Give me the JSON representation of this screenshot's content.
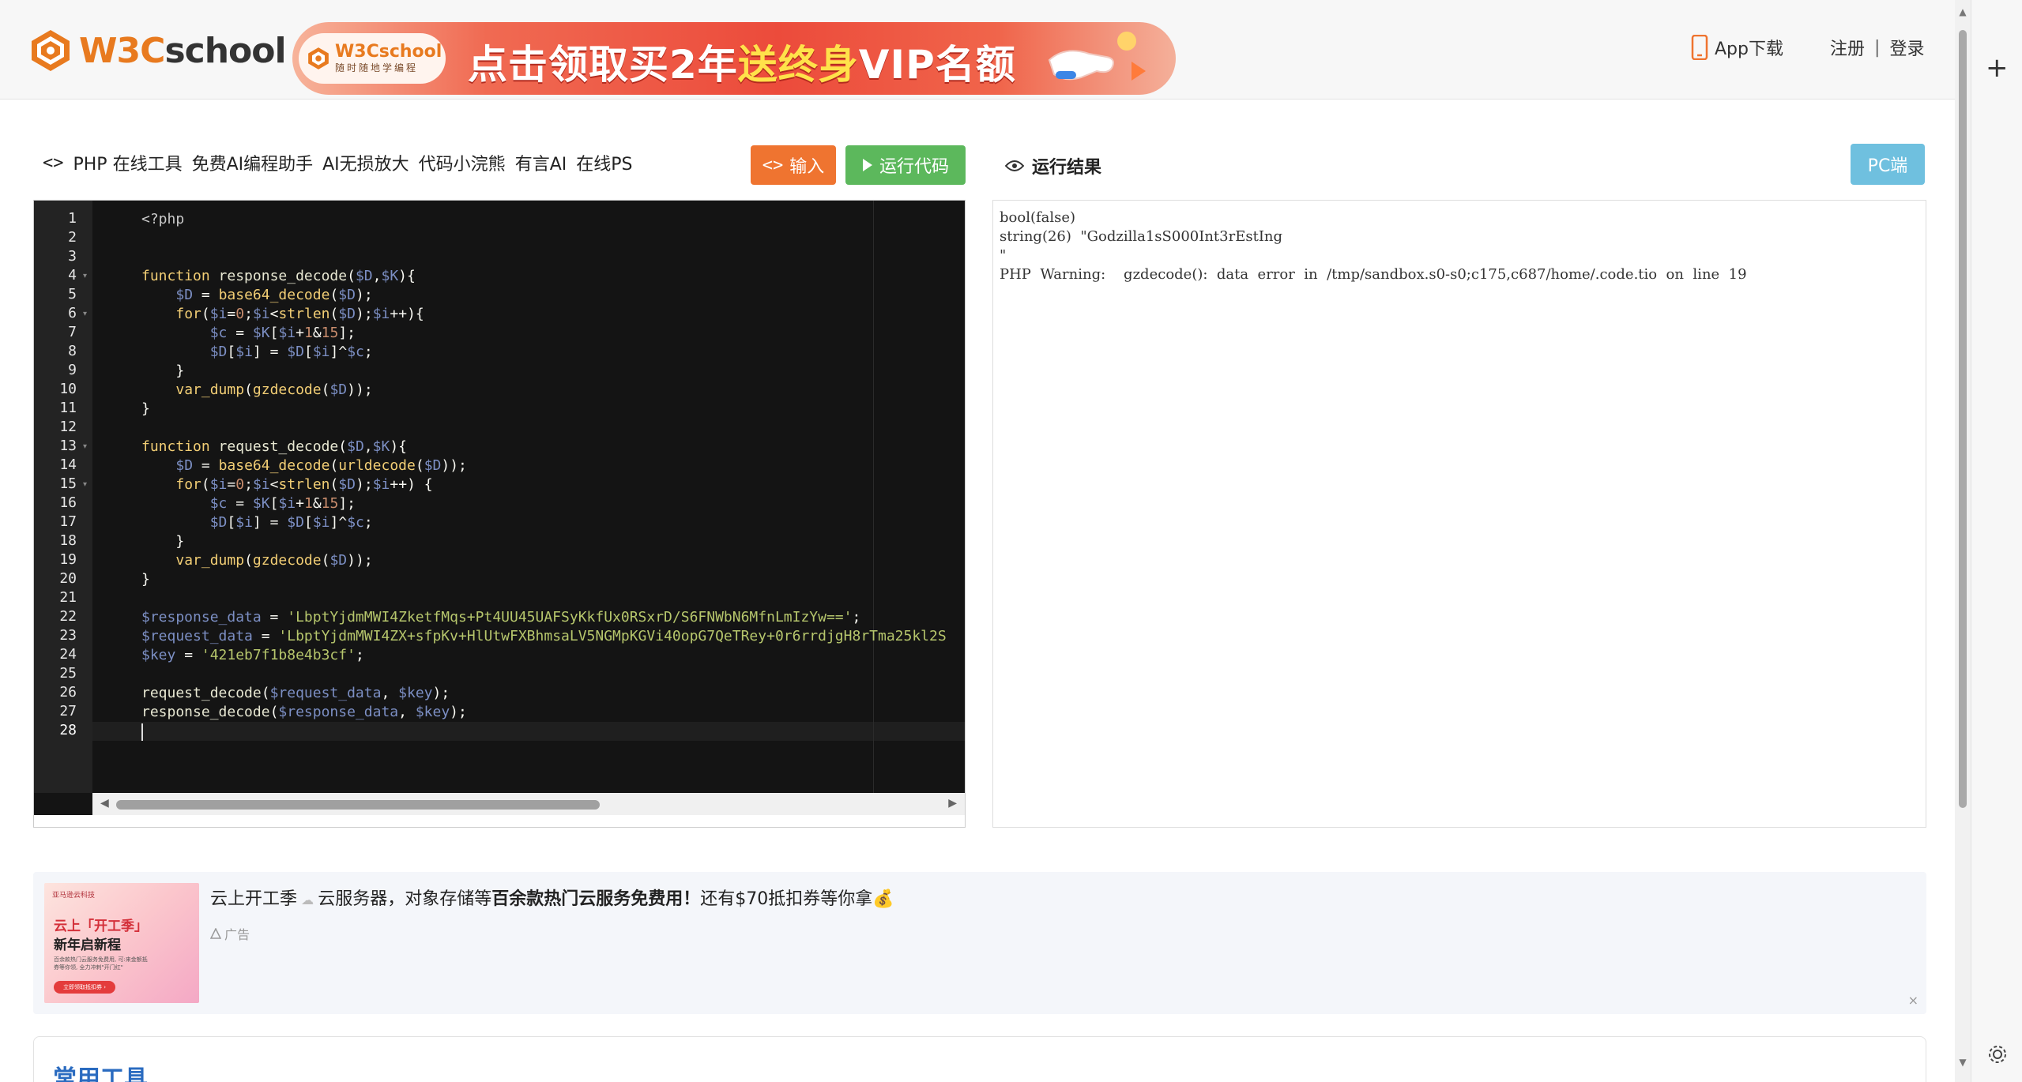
{
  "header": {
    "logo_w3c": "W3C",
    "logo_school": "school",
    "banner": {
      "badge_logo": "W3Cschool",
      "badge_sub": "随时随地学编程",
      "text_before": "点击领取买2年",
      "text_highlight": "送终身",
      "text_after": "VIP名额"
    },
    "app_download": "App下载",
    "register": "注册",
    "divider": "|",
    "login": "登录"
  },
  "toolbar": {
    "title_links": [
      "PHP 在线工具",
      "免费AI编程助手",
      "AI无损放大",
      "代码小浣熊",
      "有言AI",
      "在线PS"
    ],
    "input_label": "输入",
    "run_label": "运行代码",
    "result_label": "运行结果",
    "pc_label": "PC端"
  },
  "editor": {
    "line_numbers": [
      "1",
      "2",
      "3",
      "4",
      "5",
      "6",
      "7",
      "8",
      "9",
      "10",
      "11",
      "12",
      "13",
      "14",
      "15",
      "16",
      "17",
      "18",
      "19",
      "20",
      "21",
      "22",
      "23",
      "24",
      "25",
      "26",
      "27",
      "28"
    ],
    "active_line": 28
  },
  "output": {
    "text": "bool(false)\nstring(26)  \"Godzilla1sS000Int3rEstIng\n\"\nPHP  Warning:    gzdecode():  data  error  in  /tmp/sandbox.s0-s0;c175,c687/home/.code.tio  on  line  19"
  },
  "ad": {
    "image": {
      "small": "亚马逊云科技",
      "t1": "云上「开工季」",
      "t2": "新年启新程",
      "t3": "百余款热门云服务免费用, 可:来金额抵券等你领, 全力冲刺\"开门红\"",
      "cta": "立即领取抵扣券 ›"
    },
    "text_before": "云上开工季",
    "text_mid": "云服务器，对象存储等",
    "text_bold": "百余款热门云服务免费用！",
    "text_after": "还有$70抵扣券等你拿",
    "tag": "广告",
    "close": "×"
  },
  "common_tools": {
    "title": "常用工具"
  },
  "colors": {
    "accent_orange": "#ef7430",
    "run_green": "#5cb85c",
    "pc_blue": "#6fc0df",
    "editor_bg": "#141414"
  }
}
